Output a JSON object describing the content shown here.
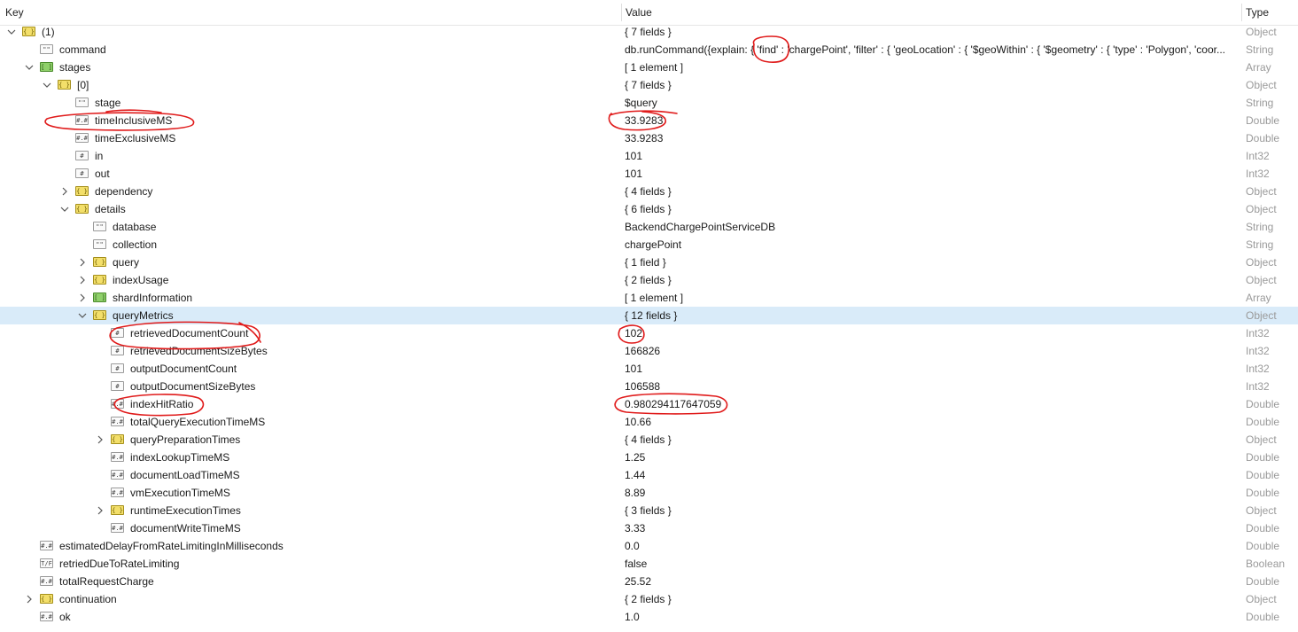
{
  "columns": {
    "key": "Key",
    "value": "Value",
    "type": "Type"
  },
  "rows": [
    {
      "key": "(1)",
      "value": "{ 7 fields }",
      "type": "Object",
      "depth": 0,
      "icon": "object",
      "expand": "open"
    },
    {
      "key": "command",
      "value": "db.runCommand({explain: { 'find' : 'chargePoint', 'filter' : { 'geoLocation' : { '$geoWithin' : { '$geometry' : { 'type' : 'Polygon', 'coor...",
      "type": "String",
      "depth": 1,
      "icon": "string",
      "expand": "none"
    },
    {
      "key": "stages",
      "value": "[ 1 element ]",
      "type": "Array",
      "depth": 1,
      "icon": "array",
      "expand": "open"
    },
    {
      "key": "[0]",
      "value": "{ 7 fields }",
      "type": "Object",
      "depth": 2,
      "icon": "object",
      "expand": "open"
    },
    {
      "key": "stage",
      "value": "$query",
      "type": "String",
      "depth": 3,
      "icon": "string",
      "expand": "none"
    },
    {
      "key": "timeInclusiveMS",
      "value": "33.9283",
      "type": "Double",
      "depth": 3,
      "icon": "double",
      "expand": "none"
    },
    {
      "key": "timeExclusiveMS",
      "value": "33.9283",
      "type": "Double",
      "depth": 3,
      "icon": "double",
      "expand": "none"
    },
    {
      "key": "in",
      "value": "101",
      "type": "Int32",
      "depth": 3,
      "icon": "int",
      "expand": "none"
    },
    {
      "key": "out",
      "value": "101",
      "type": "Int32",
      "depth": 3,
      "icon": "int",
      "expand": "none"
    },
    {
      "key": "dependency",
      "value": "{ 4 fields }",
      "type": "Object",
      "depth": 3,
      "icon": "object",
      "expand": "closed"
    },
    {
      "key": "details",
      "value": "{ 6 fields }",
      "type": "Object",
      "depth": 3,
      "icon": "object",
      "expand": "open"
    },
    {
      "key": "database",
      "value": "BackendChargePointServiceDB",
      "type": "String",
      "depth": 4,
      "icon": "string",
      "expand": "none"
    },
    {
      "key": "collection",
      "value": "chargePoint",
      "type": "String",
      "depth": 4,
      "icon": "string",
      "expand": "none"
    },
    {
      "key": "query",
      "value": "{ 1 field }",
      "type": "Object",
      "depth": 4,
      "icon": "object",
      "expand": "closed"
    },
    {
      "key": "indexUsage",
      "value": "{ 2 fields }",
      "type": "Object",
      "depth": 4,
      "icon": "object",
      "expand": "closed"
    },
    {
      "key": "shardInformation",
      "value": "[ 1 element ]",
      "type": "Array",
      "depth": 4,
      "icon": "array",
      "expand": "closed"
    },
    {
      "key": "queryMetrics",
      "value": "{ 12 fields }",
      "type": "Object",
      "depth": 4,
      "icon": "object",
      "expand": "open",
      "selected": true
    },
    {
      "key": "retrievedDocumentCount",
      "value": "102",
      "type": "Int32",
      "depth": 5,
      "icon": "int",
      "expand": "none"
    },
    {
      "key": "retrievedDocumentSizeBytes",
      "value": "166826",
      "type": "Int32",
      "depth": 5,
      "icon": "int",
      "expand": "none"
    },
    {
      "key": "outputDocumentCount",
      "value": "101",
      "type": "Int32",
      "depth": 5,
      "icon": "int",
      "expand": "none"
    },
    {
      "key": "outputDocumentSizeBytes",
      "value": "106588",
      "type": "Int32",
      "depth": 5,
      "icon": "int",
      "expand": "none"
    },
    {
      "key": "indexHitRatio",
      "value": "0.980294117647059",
      "type": "Double",
      "depth": 5,
      "icon": "double",
      "expand": "none"
    },
    {
      "key": "totalQueryExecutionTimeMS",
      "value": "10.66",
      "type": "Double",
      "depth": 5,
      "icon": "double",
      "expand": "none"
    },
    {
      "key": "queryPreparationTimes",
      "value": "{ 4 fields }",
      "type": "Object",
      "depth": 5,
      "icon": "object",
      "expand": "closed"
    },
    {
      "key": "indexLookupTimeMS",
      "value": "1.25",
      "type": "Double",
      "depth": 5,
      "icon": "double",
      "expand": "none"
    },
    {
      "key": "documentLoadTimeMS",
      "value": "1.44",
      "type": "Double",
      "depth": 5,
      "icon": "double",
      "expand": "none"
    },
    {
      "key": "vmExecutionTimeMS",
      "value": "8.89",
      "type": "Double",
      "depth": 5,
      "icon": "double",
      "expand": "none"
    },
    {
      "key": "runtimeExecutionTimes",
      "value": "{ 3 fields }",
      "type": "Object",
      "depth": 5,
      "icon": "object",
      "expand": "closed"
    },
    {
      "key": "documentWriteTimeMS",
      "value": "3.33",
      "type": "Double",
      "depth": 5,
      "icon": "double",
      "expand": "none"
    },
    {
      "key": "estimatedDelayFromRateLimitingInMilliseconds",
      "value": "0.0",
      "type": "Double",
      "depth": 1,
      "icon": "double",
      "expand": "none"
    },
    {
      "key": "retriedDueToRateLimiting",
      "value": "false",
      "type": "Boolean",
      "depth": 1,
      "icon": "bool",
      "expand": "none"
    },
    {
      "key": "totalRequestCharge",
      "value": "25.52",
      "type": "Double",
      "depth": 1,
      "icon": "double",
      "expand": "none"
    },
    {
      "key": "continuation",
      "value": "{ 2 fields }",
      "type": "Object",
      "depth": 1,
      "icon": "object",
      "expand": "closed"
    },
    {
      "key": "ok",
      "value": "1.0",
      "type": "Double",
      "depth": 1,
      "icon": "double",
      "expand": "none"
    }
  ],
  "icon_glyphs": {
    "object": "{ }",
    "array": "[ ]",
    "string": "\"\"",
    "double": "#.#",
    "int": "#",
    "bool": "T/F"
  },
  "colors": {
    "selection": "#cce8ff",
    "annotation": "#e01b1b",
    "object_icon": "#f3df6a",
    "array_icon": "#8fd06a"
  }
}
